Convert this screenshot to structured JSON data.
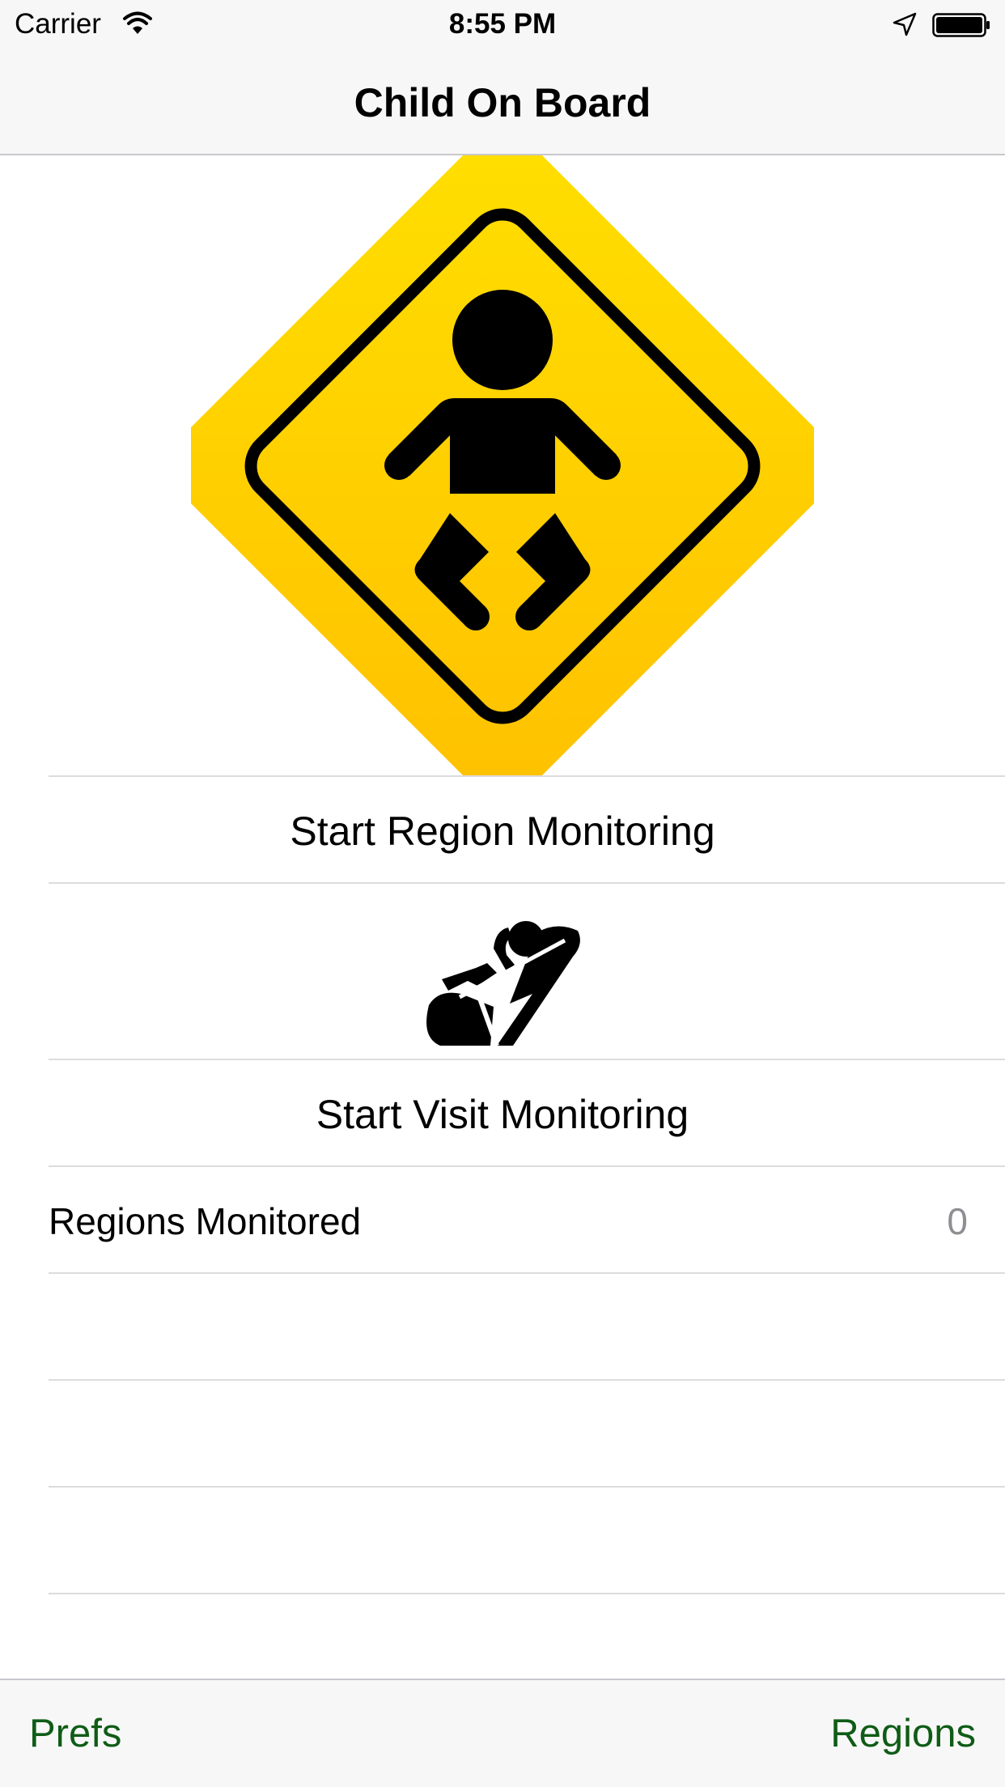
{
  "status_bar": {
    "carrier": "Carrier",
    "time": "8:55 PM",
    "icons": [
      "wifi-icon",
      "location-arrow-icon",
      "battery-icon"
    ]
  },
  "nav": {
    "title": "Child On Board"
  },
  "hero": {
    "icon": "child-on-board-sign-icon",
    "colors": [
      "#ffde00",
      "#ffc200",
      "#000000"
    ]
  },
  "actions": {
    "start_region": "Start Region Monitoring",
    "start_visit": "Start Visit Monitoring",
    "seat_icon": "car-seat-icon"
  },
  "regions_row": {
    "label": "Regions Monitored",
    "value": "0"
  },
  "toolbar": {
    "prefs": "Prefs",
    "regions": "Regions",
    "tint_color": "#0f5c16"
  }
}
